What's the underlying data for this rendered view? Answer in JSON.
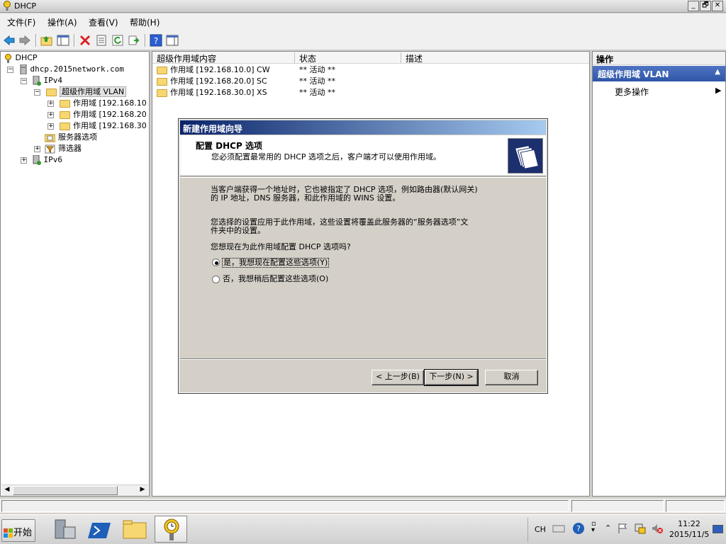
{
  "window": {
    "title": "DHCP",
    "controls": {
      "minimize": "_",
      "restore": "🗗",
      "close": "✕"
    }
  },
  "menu": [
    "文件(F)",
    "操作(A)",
    "查看(V)",
    "帮助(H)"
  ],
  "toolbar": {
    "icons": [
      "back-arrow-icon",
      "forward-arrow-icon",
      "up-folder-icon",
      "show-hide-tree-icon",
      "delete-icon",
      "properties-icon",
      "refresh-icon",
      "export-list-icon",
      "help-icon",
      "action-pane-icon"
    ]
  },
  "tree": {
    "root": "DHCP",
    "server": "dhcp.2015network.com",
    "ipv4": "IPv4",
    "superscope": "超级作用域 VLAN",
    "scopes": [
      "作用域 [192.168.10",
      "作用域 [192.168.20",
      "作用域 [192.168.30"
    ],
    "server_options": "服务器选项",
    "filters": "筛选器",
    "ipv6": "IPv6"
  },
  "list": {
    "columns": [
      "超级作用域内容",
      "状态",
      "描述"
    ],
    "rows": [
      {
        "name": "作用域 [192.168.10.0] CW",
        "status": "** 活动 **",
        "desc": ""
      },
      {
        "name": "作用域 [192.168.20.0] SC",
        "status": "** 活动 **",
        "desc": ""
      },
      {
        "name": "作用域 [192.168.30.0] XS",
        "status": "** 活动 **",
        "desc": ""
      }
    ]
  },
  "actions": {
    "header": "操作",
    "section": "超级作用域 VLAN",
    "more": "更多操作"
  },
  "wizard": {
    "title": "新建作用域向导",
    "heading": "配置 DHCP 选项",
    "subheading": "您必须配置最常用的 DHCP 选项之后，客户端才可以使用作用域。",
    "para1_line1": "当客户端获得一个地址时，它也被指定了 DHCP 选项，例如路由器(默认网关)",
    "para1_line2": "的 IP 地址，DNS 服务器，和此作用域的 WINS 设置。",
    "para2_line1": "您选择的设置应用于此作用域，这些设置将覆盖此服务器的“服务器选项”文",
    "para2_line2": "件夹中的设置。",
    "question": "您想现在为此作用域配置 DHCP 选项吗?",
    "option_yes": "是，我想现在配置这些选项(Y)",
    "option_no": "否，我想稍后配置这些选项(O)",
    "selected": "yes",
    "btn_back": "< 上一步(B)",
    "btn_next": "下一步(N) >",
    "btn_cancel": "取消"
  },
  "taskbar": {
    "start": "开始",
    "apps": [
      "server-manager-icon",
      "powershell-icon",
      "explorer-icon",
      "dhcp-icon"
    ],
    "lang": "CH",
    "time": "11:22",
    "date": "2015/11/5"
  }
}
